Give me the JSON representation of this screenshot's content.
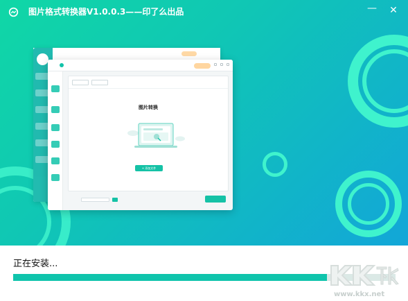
{
  "window": {
    "title": "图片格式转换器V1.0.0.3——印了么出品",
    "minimize_glyph": "—",
    "close_glyph": "✕"
  },
  "colors": {
    "accent": "#0fc4ac",
    "hero_start": "#10d7a6",
    "hero_end": "#12a6d8",
    "rings": "#3ff3cd"
  },
  "icons": [
    "app-logo-icon",
    "minimize-icon",
    "close-icon"
  ],
  "preview": {
    "heading": "图片转换",
    "add_button": "+ 添加文件"
  },
  "install": {
    "status": "正在安装...",
    "progress": 0.82
  },
  "watermark": {
    "logo_text": "KK下载",
    "url": "www.kkx.net"
  }
}
